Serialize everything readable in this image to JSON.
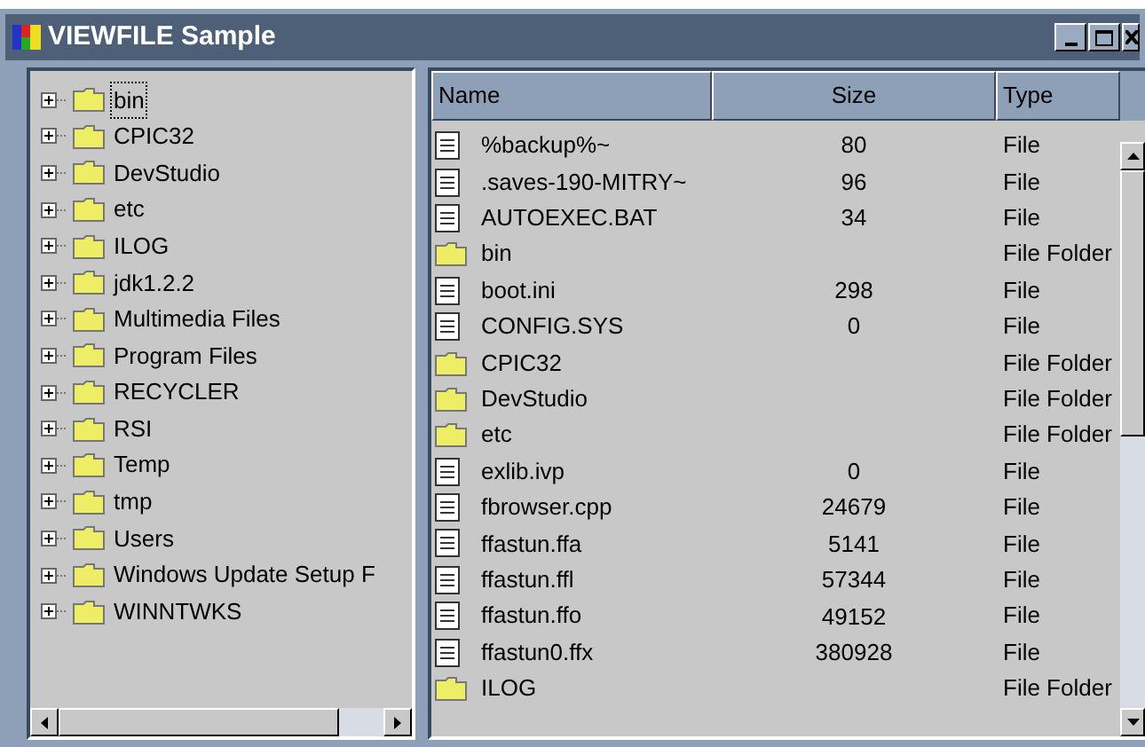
{
  "window": {
    "title": "VIEWFILE Sample"
  },
  "tree": {
    "items": [
      {
        "label": "bin",
        "selected": true
      },
      {
        "label": "CPIC32",
        "selected": false
      },
      {
        "label": "DevStudio",
        "selected": false
      },
      {
        "label": "etc",
        "selected": false
      },
      {
        "label": "ILOG",
        "selected": false
      },
      {
        "label": "jdk1.2.2",
        "selected": false
      },
      {
        "label": "Multimedia Files",
        "selected": false
      },
      {
        "label": "Program Files",
        "selected": false
      },
      {
        "label": "RECYCLER",
        "selected": false
      },
      {
        "label": "RSI",
        "selected": false
      },
      {
        "label": "Temp",
        "selected": false
      },
      {
        "label": "tmp",
        "selected": false
      },
      {
        "label": "Users",
        "selected": false
      },
      {
        "label": "Windows Update Setup F",
        "selected": false
      },
      {
        "label": "WINNTWKS",
        "selected": false
      }
    ]
  },
  "list": {
    "columns": [
      "Name",
      "Size",
      "Type"
    ],
    "rows": [
      {
        "kind": "file",
        "name": "%backup%~",
        "size": "80",
        "type": "File"
      },
      {
        "kind": "file",
        "name": ".saves-190-MITRY~",
        "size": "96",
        "type": "File"
      },
      {
        "kind": "file",
        "name": "AUTOEXEC.BAT",
        "size": "34",
        "type": "File"
      },
      {
        "kind": "folder",
        "name": "bin",
        "type": "File Folder"
      },
      {
        "kind": "file",
        "name": "boot.ini",
        "size": "298",
        "type": "File"
      },
      {
        "kind": "file",
        "name": "CONFIG.SYS",
        "size": "0",
        "type": "File"
      },
      {
        "kind": "folder",
        "name": "CPIC32",
        "type": "File Folder"
      },
      {
        "kind": "folder",
        "name": "DevStudio",
        "type": "File Folder"
      },
      {
        "kind": "folder",
        "name": "etc",
        "type": "File Folder"
      },
      {
        "kind": "file",
        "name": "exlib.ivp",
        "size": "0",
        "type": "File"
      },
      {
        "kind": "file",
        "name": "fbrowser.cpp",
        "size": "24679",
        "type": "File"
      },
      {
        "kind": "file",
        "name": "ffastun.ffa",
        "size": "5141",
        "type": "File"
      },
      {
        "kind": "file",
        "name": "ffastun.ffl",
        "size": "57344",
        "type": "File"
      },
      {
        "kind": "file",
        "name": "ffastun.ffo",
        "size": "49152",
        "type": "File"
      },
      {
        "kind": "file",
        "name": "ffastun0.ffx",
        "size": "380928",
        "type": "File"
      },
      {
        "kind": "folder",
        "name": "ILOG",
        "type": "File Folder"
      }
    ]
  }
}
